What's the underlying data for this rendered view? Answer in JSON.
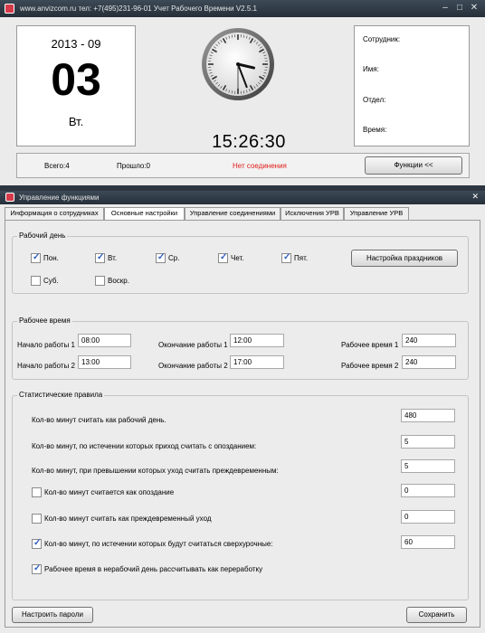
{
  "main_window": {
    "title": "www.anvizcom.ru   тел: +7(495)231-96-01   Учет Рабочего Времени V2.5.1",
    "year_month": "2013 - 09",
    "day": "03",
    "weekday": "Вт.",
    "time": "15:26:30",
    "info": {
      "employee": "Сотрудник:",
      "name": "Имя:",
      "department": "Отдел:",
      "time": "Время:"
    },
    "status": {
      "total": "Всего:4",
      "passed": "Прошло:0",
      "connection": "Нет соединения"
    },
    "functions_button": "Функции <<"
  },
  "clock": {
    "hours": 15,
    "minutes": 26,
    "seconds": 30
  },
  "functions_window": {
    "title": "Управление функциями",
    "tabs": [
      "Информация о сотрудниках",
      "Основные настройки",
      "Управление соединениями",
      "Исключения УРВ",
      "Управление УРВ"
    ],
    "active_tab": 1
  },
  "workdays": {
    "title": "Рабочий день",
    "days": [
      {
        "label": "Пон.",
        "checked": true
      },
      {
        "label": "Вт.",
        "checked": true
      },
      {
        "label": "Ср.",
        "checked": true
      },
      {
        "label": "Чет.",
        "checked": true
      },
      {
        "label": "Пят.",
        "checked": true
      },
      {
        "label": "Суб.",
        "checked": false
      },
      {
        "label": "Воскр.",
        "checked": false
      }
    ],
    "holidays_button": "Настройка праздников"
  },
  "worktime": {
    "title": "Рабочее время",
    "start1_label": "Начало работы 1",
    "start1": "08:00",
    "end1_label": "Окончание работы 1",
    "end1": "12:00",
    "work1_label": "Рабочее время 1",
    "work1": "240",
    "start2_label": "Начало работы 2",
    "start2": "13:00",
    "end2_label": "Окончание работы 2",
    "end2": "17:00",
    "work2_label": "Рабочее время 2",
    "work2": "240"
  },
  "stats": {
    "title": "Статистические правила",
    "rules": [
      {
        "label": "Кол-во минут считать как рабочий день.",
        "value": "480",
        "has_checkbox": false,
        "checked": false
      },
      {
        "label": "Кол-во минут, по истечении которых приход считать с опозданием:",
        "value": "5",
        "has_checkbox": false,
        "checked": false
      },
      {
        "label": "Кол-во минут, при превышении которых уход считать преждевременным:",
        "value": "5",
        "has_checkbox": false,
        "checked": false
      },
      {
        "label": "Кол-во минут считается как опоздание",
        "value": "0",
        "has_checkbox": true,
        "checked": false
      },
      {
        "label": "Кол-во минут считать как преждевременный уход",
        "value": "0",
        "has_checkbox": true,
        "checked": false
      },
      {
        "label": "Кол-во минут, по истечении которых будут считаться сверхурочные:",
        "value": "60",
        "has_checkbox": true,
        "checked": true
      },
      {
        "label": "Рабочее время в нерабочий день рассчитывать как переработку",
        "value": "",
        "has_checkbox": true,
        "checked": true
      }
    ]
  },
  "buttons": {
    "passwords": "Настроить пароли",
    "save": "Сохранить"
  }
}
